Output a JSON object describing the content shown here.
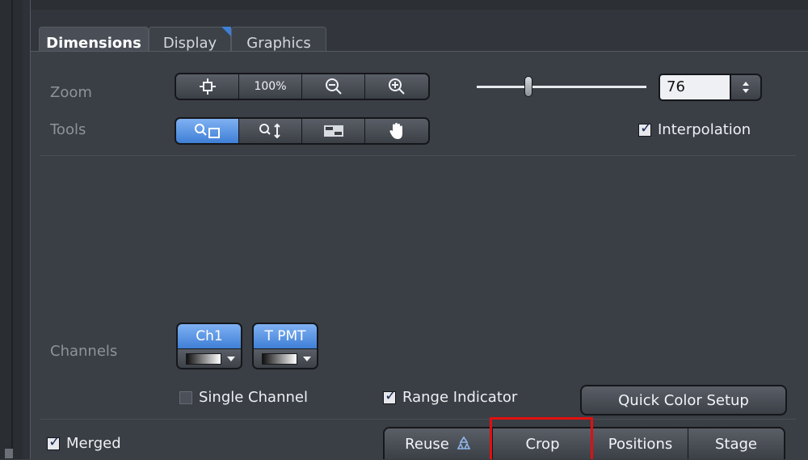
{
  "tabs": [
    {
      "label": "Dimensions",
      "active": true
    },
    {
      "label": "Display",
      "active": false
    },
    {
      "label": "Graphics",
      "active": false
    }
  ],
  "zoom": {
    "label": "Zoom",
    "buttons": [
      "fit-to-frame-icon",
      "100%",
      "zoom-out-icon",
      "zoom-in-icon"
    ],
    "hundred_label": "100%",
    "value": "76",
    "slider_fraction": 0.28
  },
  "tools": {
    "label": "Tools",
    "buttons": [
      "zoom-rect-icon",
      "zoom-vertical-icon",
      "move-icon",
      "hand-icon"
    ],
    "active_index": 0
  },
  "interpolation": {
    "label": "Interpolation",
    "checked": true
  },
  "channels": {
    "label": "Channels",
    "items": [
      {
        "name": "Ch1"
      },
      {
        "name": "T PMT"
      }
    ]
  },
  "single_channel": {
    "label": "Single Channel",
    "checked": false
  },
  "range_indicator": {
    "label": "Range Indicator",
    "checked": true
  },
  "quick_color_setup": {
    "label": "Quick Color Setup"
  },
  "merged": {
    "label": "Merged",
    "checked": true
  },
  "bottom_buttons": {
    "reuse": "Reuse",
    "crop": "Crop",
    "positions": "Positions",
    "stage": "Stage"
  },
  "colors": {
    "accent": "#3f7fd6",
    "highlight": "#e01010",
    "panel": "#3a3e45"
  }
}
